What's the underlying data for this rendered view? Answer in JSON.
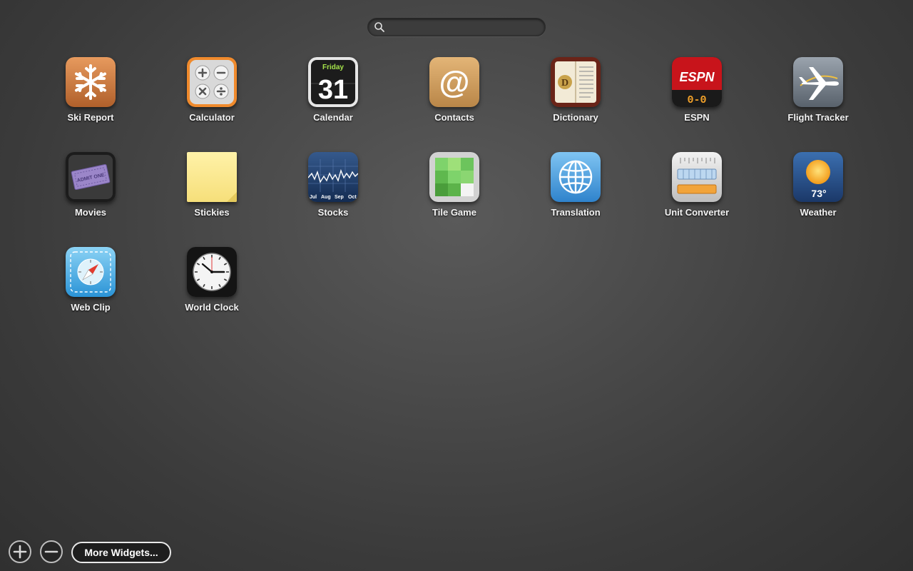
{
  "search": {
    "placeholder": "",
    "icon": "search-icon"
  },
  "widgets": [
    {
      "label": "Ski Report",
      "icon": "snowflake-icon"
    },
    {
      "label": "Calculator",
      "icon": "calculator-icon"
    },
    {
      "label": "Calendar",
      "icon": "calendar-icon",
      "day_name": "Friday",
      "day_number": "31"
    },
    {
      "label": "Contacts",
      "icon": "at-sign-icon"
    },
    {
      "label": "Dictionary",
      "icon": "dictionary-icon",
      "letter": "D"
    },
    {
      "label": "ESPN",
      "icon": "espn-icon",
      "logo": "ESPN",
      "score": "0-0"
    },
    {
      "label": "Flight Tracker",
      "icon": "airplane-icon"
    },
    {
      "label": "Movies",
      "icon": "movie-ticket-icon",
      "ticket_text": "ADMIT ONE"
    },
    {
      "label": "Stickies",
      "icon": "sticky-note-icon"
    },
    {
      "label": "Stocks",
      "icon": "stock-chart-icon",
      "months": [
        "Jul",
        "Aug",
        "Sep",
        "Oct"
      ]
    },
    {
      "label": "Tile Game",
      "icon": "tile-game-icon"
    },
    {
      "label": "Translation",
      "icon": "globe-icon"
    },
    {
      "label": "Unit Converter",
      "icon": "unit-converter-icon"
    },
    {
      "label": "Weather",
      "icon": "weather-sun-icon",
      "temperature": "73°"
    },
    {
      "label": "Web Clip",
      "icon": "compass-icon"
    },
    {
      "label": "World Clock",
      "icon": "clock-icon"
    }
  ],
  "bottom_bar": {
    "add_icon": "plus-icon",
    "remove_icon": "minus-icon",
    "more_widgets_label": "More Widgets..."
  }
}
